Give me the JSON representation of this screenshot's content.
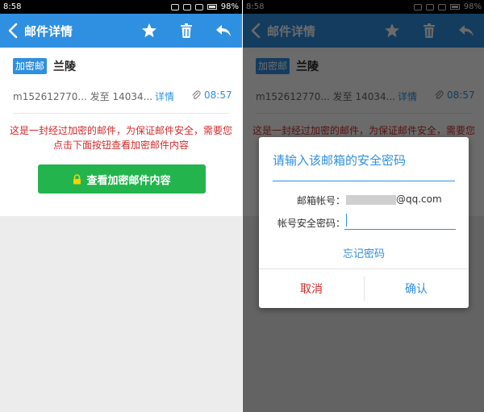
{
  "status_bar": {
    "time": "8:58",
    "battery": "98%"
  },
  "app_bar": {
    "title": "邮件详情"
  },
  "mail": {
    "tag": "加密邮",
    "subject": "兰陵",
    "from_line": "m152612770... 发至 14034...",
    "detail_link": "详情",
    "time": "08:57",
    "notice": "这是一封经过加密的邮件，为保证邮件安全，需要您点击下面按钮查看加密邮件内容",
    "open_button": "查看加密邮件内容"
  },
  "dialog": {
    "title": "请输入该邮箱的安全密码",
    "account_label": "邮箱帐号：",
    "account_suffix": "@qq.com",
    "password_label": "帐号安全密码：",
    "password_value": "",
    "forgot": "忘记密码",
    "cancel": "取消",
    "confirm": "确认"
  },
  "colors": {
    "primary": "#2f8fe1",
    "warning": "#d42b2b",
    "button_green": "#24b44e"
  },
  "icons": [
    "back-arrow-icon",
    "star-icon",
    "trash-icon",
    "reply-icon",
    "attachment-clip-icon",
    "lock-icon"
  ]
}
